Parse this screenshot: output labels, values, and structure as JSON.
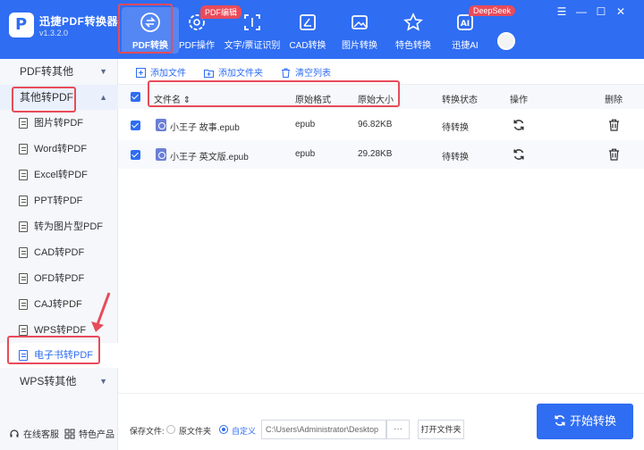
{
  "app": {
    "name": "迅捷PDF转换器",
    "version": "v1.3.2.0"
  },
  "nav": {
    "tabs": [
      {
        "label": "PDF转换"
      },
      {
        "label": "PDF操作"
      },
      {
        "label": "文字/票证识别"
      },
      {
        "label": "CAD转换"
      },
      {
        "label": "图片转换"
      },
      {
        "label": "特色转换"
      },
      {
        "label": "迅捷AI"
      }
    ],
    "badges": {
      "pdf_edit": "PDF编辑",
      "deepseek": "DeepSeek"
    },
    "window": {
      "menu": "☰",
      "minimize": "—",
      "maximize": "☐",
      "close": "✕"
    }
  },
  "sidebar": {
    "groups": {
      "pdf_to_other": "PDF转其他",
      "other_to_pdf": "其他转PDF",
      "wps_to_other": "WPS转其他"
    },
    "items": [
      {
        "label": "图片转PDF"
      },
      {
        "label": "Word转PDF"
      },
      {
        "label": "Excel转PDF"
      },
      {
        "label": "PPT转PDF"
      },
      {
        "label": "转为图片型PDF"
      },
      {
        "label": "CAD转PDF"
      },
      {
        "label": "OFD转PDF"
      },
      {
        "label": "CAJ转PDF"
      },
      {
        "label": "WPS转PDF"
      },
      {
        "label": "电子书转PDF"
      }
    ],
    "footer": {
      "service": "在线客服",
      "products": "特色产品"
    }
  },
  "toolbar": {
    "add_file": "添加文件",
    "add_folder": "添加文件夹",
    "clear_list": "清空列表"
  },
  "table": {
    "headers": {
      "filename": "文件名",
      "sort": "⇕",
      "format": "原始格式",
      "size": "原始大小",
      "status": "转换状态",
      "action": "操作",
      "delete": "删除"
    },
    "rows": [
      {
        "name": "小王子 故事.epub",
        "format": "epub",
        "size": "96.82KB",
        "status": "待转换"
      },
      {
        "name": "小王子 英文版.epub",
        "format": "epub",
        "size": "29.28KB",
        "status": "待转换"
      }
    ]
  },
  "bottom": {
    "save_label": "保存文件:",
    "option_original": "原文件夹",
    "option_custom": "自定义",
    "path_value": "C:\\Users\\Administrator\\Desktop",
    "dots": "···",
    "open_folder": "打开文件夹",
    "start": "开始转换"
  },
  "colors": {
    "brand": "#2f6df2",
    "highlight": "#e84b5a",
    "sidebar_bg": "#f5f7fb"
  }
}
